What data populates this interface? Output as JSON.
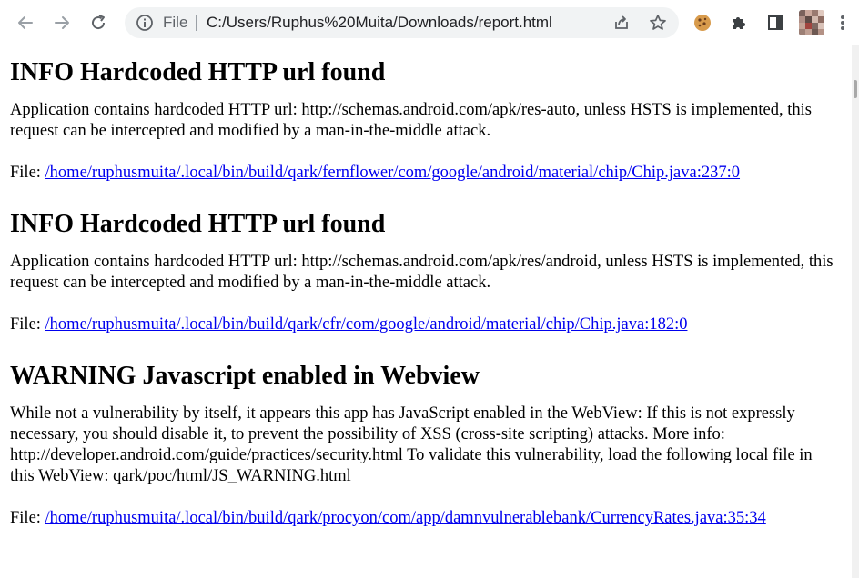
{
  "browser": {
    "omnibox_scheme_label": "File",
    "omnibox_url": "C:/Users/Ruphus%20Muita/Downloads/report.html",
    "icons": [
      "back-icon",
      "forward-icon",
      "reload-icon",
      "info-icon",
      "share-icon",
      "star-icon",
      "cookie-extension-icon",
      "extensions-puzzle-icon",
      "side-panel-icon",
      "profile-avatar"
    ]
  },
  "report": {
    "findings": [
      {
        "title": "INFO Hardcoded HTTP url found",
        "description": "Application contains hardcoded HTTP url: http://schemas.android.com/apk/res-auto, unless HSTS is implemented, this request can be intercepted and modified by a man-in-the-middle attack.",
        "file_label": "File:",
        "file_link": "/home/ruphusmuita/.local/bin/build/qark/fernflower/com/google/android/material/chip/Chip.java:237:0"
      },
      {
        "title": "INFO Hardcoded HTTP url found",
        "description": "Application contains hardcoded HTTP url: http://schemas.android.com/apk/res/android, unless HSTS is implemented, this request can be intercepted and modified by a man-in-the-middle attack.",
        "file_label": "File:",
        "file_link": "/home/ruphusmuita/.local/bin/build/qark/cfr/com/google/android/material/chip/Chip.java:182:0"
      },
      {
        "title": "WARNING Javascript enabled in Webview",
        "description": "While not a vulnerability by itself, it appears this app has JavaScript enabled in the WebView: If this is not expressly necessary, you should disable it, to prevent the possibility of XSS (cross-site scripting) attacks. More info: http://developer.android.com/guide/practices/security.html To validate this vulnerability, load the following local file in this WebView: qark/poc/html/JS_WARNING.html",
        "file_label": "File:",
        "file_link": "/home/ruphusmuita/.local/bin/build/qark/procyon/com/app/damnvulnerablebank/CurrencyRates.java:35:34"
      }
    ]
  },
  "colors": {
    "link": "#0000ee",
    "toolbar_bg": "#ffffff",
    "omnibox_bg": "#f1f3f4"
  }
}
